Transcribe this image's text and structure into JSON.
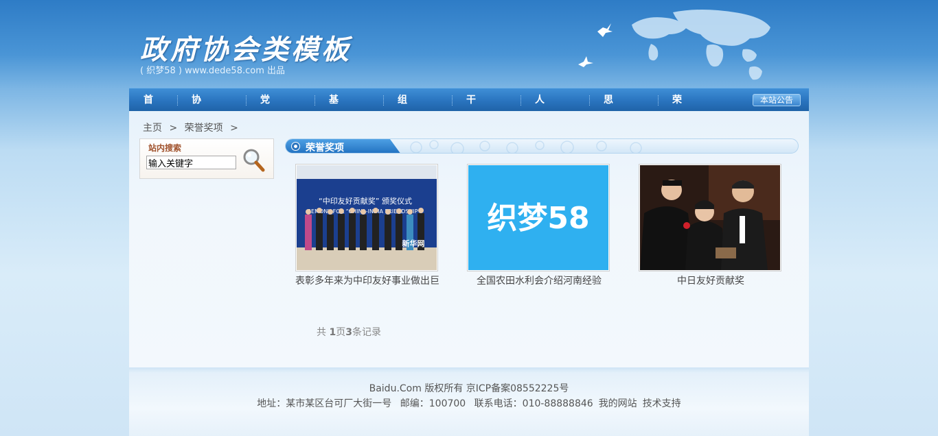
{
  "header": {
    "logo_title": "政府协会类模板",
    "logo_sub": "( 织梦58 ) www.dede58.com  出品"
  },
  "nav": {
    "items": [
      "首页",
      "协会简介",
      "党建动态",
      "基层党建",
      "组工指南",
      "干部工作",
      "人才工作",
      "思想建设",
      "荣誉奖项"
    ],
    "notice": "本站公告"
  },
  "breadcrumb": {
    "home": "主页",
    "sep": ">",
    "current": "荣誉奖项",
    "sep2": ">"
  },
  "search": {
    "title": "站内搜索",
    "placeholder": "输入关键字"
  },
  "section": {
    "title": "荣誉奖项"
  },
  "items": [
    {
      "caption": "表彰多年来为中印友好事业做出巨",
      "banner": "“中印友好贡献奖” 颁奖仪式",
      "banner2": "REMONY FOR “CHINA-INDIA FRIENDSHIP",
      "watermark": "新华网"
    },
    {
      "caption": "全国农田水利会介绍河南经验",
      "logo_text": "织梦58"
    },
    {
      "caption": "中日友好贡献奖"
    }
  ],
  "pager": {
    "prefix": "共",
    "pages": "1",
    "pages_unit": "页",
    "records": "3",
    "records_unit": "条记录"
  },
  "footer": {
    "copyright": "Baidu.Com 版权所有  京ICP备案08552225号",
    "address": "地址：某市某区台可厂大街一号",
    "postcode": "邮编：100700",
    "phone": "联系电话：010-88888846",
    "link_site": "我的网站",
    "link_support": "技术支持"
  },
  "colors": {
    "nav": "#2a74bf",
    "accent": "#2a74bf",
    "search_title": "#a0522d"
  }
}
